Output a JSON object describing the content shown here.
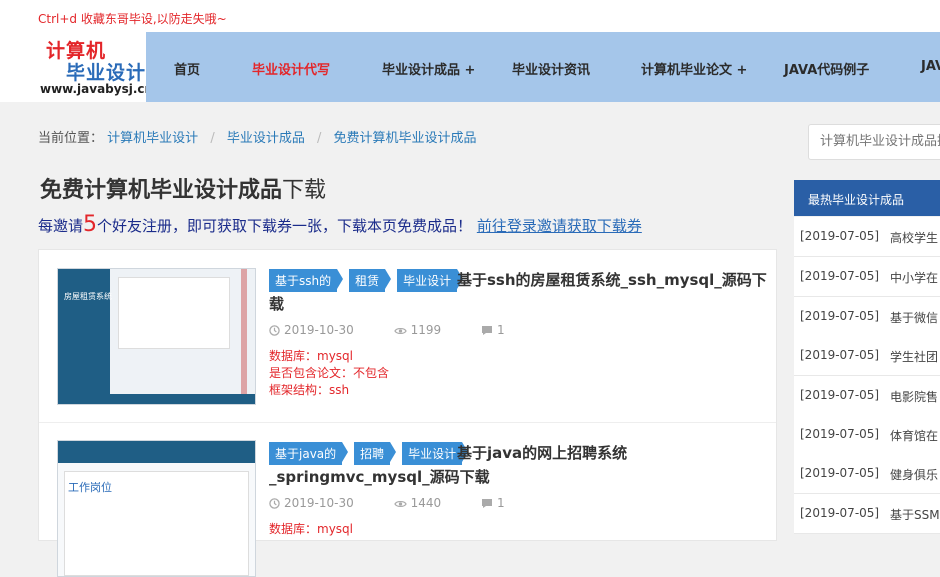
{
  "topbar": {
    "bookmark_text": "Ctrl+d 收藏东哥毕设,以防走失哦~"
  },
  "logo": {
    "line1": "计算机",
    "line2": "毕业设计",
    "domain": "www.javabysj.cn"
  },
  "nav": {
    "items": [
      {
        "label": "首页"
      },
      {
        "label": "毕业设计代写"
      },
      {
        "label": "毕业设计成品 +"
      },
      {
        "label": "毕业设计资讯"
      },
      {
        "label": "计算机毕业论文 +"
      },
      {
        "label": "JAVA代码例子"
      },
      {
        "label": "JAV"
      }
    ],
    "active_index": 1
  },
  "breadcrumb": {
    "prefix": "当前位置：",
    "items": [
      "计算机毕业设计",
      "毕业设计成品",
      "免费计算机毕业设计成品"
    ],
    "separator": "/"
  },
  "page": {
    "title_bold": "免费计算机毕业设计成品",
    "title_rest": "下载"
  },
  "invite": {
    "part1": "每邀请",
    "count": "5",
    "part2": "个好友注册，即可获取下载券一张，下载本页免费成品！",
    "link": "前往登录邀请获取下载券"
  },
  "cards": [
    {
      "tags": [
        "基于ssh的",
        "租赁",
        "毕业设计"
      ],
      "title": "基于ssh的房屋租赁系统_ssh_mysql_源码下载",
      "date": "2019-10-30",
      "views": "1199",
      "comments": "1",
      "info": [
        "数据库：mysql",
        "是否包含论文：不包含",
        "框架结构：ssh"
      ],
      "thumb_title": "房屋租赁系统"
    },
    {
      "tags": [
        "基于java的",
        "招聘",
        "毕业设计"
      ],
      "title": "基于java的网上招聘系统_springmvc_mysql_源码下载",
      "date": "2019-10-30",
      "views": "1440",
      "comments": "1",
      "info": [
        "数据库：mysql"
      ],
      "thumb_title": "工作岗位"
    }
  ],
  "sidebar": {
    "search_placeholder": "计算机毕业设计成品搜",
    "hot_title": "最热毕业设计成品",
    "hot_items": [
      {
        "date": "[2019-07-05]",
        "title": "高校学生"
      },
      {
        "date": "[2019-07-05]",
        "title": "中小学在"
      },
      {
        "date": "[2019-07-05]",
        "title": "基于微信"
      },
      {
        "date": "[2019-07-05]",
        "title": "学生社团"
      },
      {
        "date": "[2019-07-05]",
        "title": "电影院售"
      },
      {
        "date": "[2019-07-05]",
        "title": "体育馆在"
      },
      {
        "date": "[2019-07-05]",
        "title": "健身俱乐"
      },
      {
        "date": "[2019-07-05]",
        "title": "基于SSM"
      }
    ]
  },
  "colors": {
    "accent_red": "#e3262a",
    "nav_bg": "#a5c6ea",
    "tag_blue": "#3a8fd6",
    "hot_header": "#2a5fa6"
  },
  "icons": {
    "date": "clock-icon",
    "views": "eye-icon",
    "comments": "comment-icon"
  }
}
